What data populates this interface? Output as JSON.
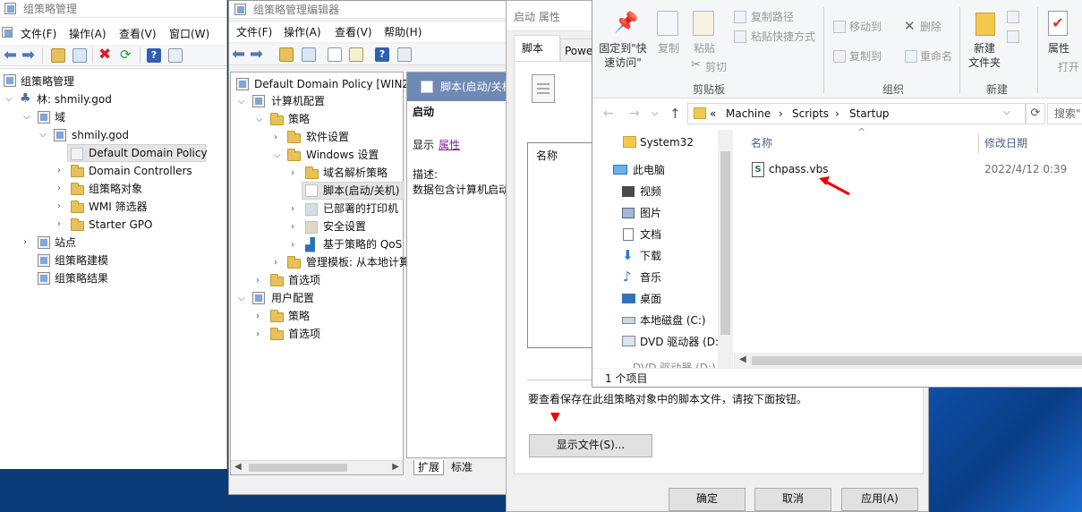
{
  "gpm": {
    "title": "组策略管理",
    "menu": [
      "文件(F)",
      "操作(A)",
      "查看(V)",
      "窗口(W)"
    ],
    "tree": {
      "root": "组策略管理",
      "forest": "林: shmily.god",
      "domains": "域",
      "domain": "shmily.god",
      "ddp": "Default Domain Policy",
      "dc": "Domain Controllers",
      "gpo": "组策略对象",
      "wmi": "WMI 筛选器",
      "starter": "Starter GPO",
      "sites": "站点",
      "modeling": "组策略建模",
      "results": "组策略结果"
    }
  },
  "gpme": {
    "title": "组策略管理编辑器",
    "menu": [
      "文件(F)",
      "操作(A)",
      "查看(V)",
      "帮助(H)"
    ],
    "tree": {
      "root": "Default Domain Policy [WIN2",
      "computer": "计算机配置",
      "policies": "策略",
      "software": "软件设置",
      "windows": "Windows 设置",
      "dns": "域名解析策略",
      "scripts": "脚本(启动/关机)",
      "printers": "已部署的打印机",
      "security": "安全设置",
      "qos": "基于策略的 QoS",
      "admin": "管理模板: 从本地计算",
      "prefs": "首选项",
      "user": "用户配置",
      "u_policies": "策略",
      "u_prefs": "首选项"
    },
    "right": {
      "header": "脚本(启动/关机",
      "startup": "启动",
      "display": "显示",
      "props_link": "属性",
      "desc_label": "描述:",
      "desc_text": "数据包含计算机启动"
    },
    "tabs": [
      "扩展",
      "标准"
    ]
  },
  "props": {
    "title": "启动 属性",
    "tabs": [
      "脚本",
      "Powe"
    ],
    "list_header": "名称",
    "hint": "要查看保存在此组策略对象中的脚本文件，请按下面按钮。",
    "show_files": "显示文件(S)...",
    "ok": "确定",
    "cancel": "取消",
    "apply": "应用(A)"
  },
  "explorer": {
    "ribbon": {
      "pin": "固定到\"快\n速访问\"",
      "copy": "复制",
      "paste": "粘贴",
      "copy_path": "复制路径",
      "paste_shortcut": "粘贴快捷方式",
      "cut": "剪切",
      "clipboard": "剪贴板",
      "move_to": "移动到",
      "copy_to": "复制到",
      "delete": "删除",
      "rename": "重命名",
      "organize": "组织",
      "new_folder": "新建\n文件夹",
      "new": "新建",
      "properties": "属性",
      "open": "打开"
    },
    "address": {
      "prefix": "«",
      "crumbs": [
        "Machine",
        "Scripts",
        "Startup"
      ],
      "search": "搜索\""
    },
    "nav": [
      "System32",
      "此电脑",
      "视频",
      "图片",
      "文档",
      "下载",
      "音乐",
      "桌面",
      "本地磁盘 (C:)",
      "DVD 驱动器 (D:",
      "DVD 驱动器 (D:)"
    ],
    "columns": {
      "name": "名称",
      "modified": "修改日期"
    },
    "files": [
      {
        "name": "chpass.vbs",
        "date": "2022/4/12 0:39"
      }
    ],
    "status": "1 个项目"
  }
}
